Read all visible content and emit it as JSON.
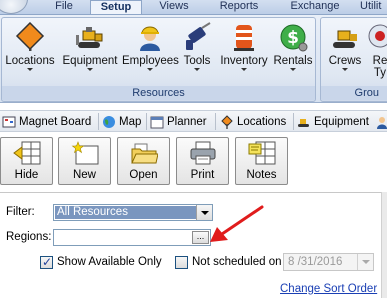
{
  "tabs": [
    {
      "label": "File"
    },
    {
      "label": "Setup"
    },
    {
      "label": "Views"
    },
    {
      "label": "Reports"
    },
    {
      "label": "Exchange"
    },
    {
      "label": "Utilit"
    }
  ],
  "ribbon": {
    "resources_label": "Resources",
    "group_label_clipped": "Grou",
    "buttons": {
      "locations": "Locations",
      "equipment": "Equipment",
      "employees": "Employees",
      "tools": "Tools",
      "inventory": "Inventory",
      "rentals": "Rentals",
      "crews": "Crews",
      "req_line1": "Re",
      "req_line2": "Ty"
    }
  },
  "navbar": {
    "magnet_board": "Magnet Board",
    "map": "Map",
    "planner": "Planner",
    "locations": "Locations",
    "equipment": "Equipment"
  },
  "actions": {
    "hide": "Hide",
    "new": "New",
    "open": "Open",
    "print": "Print",
    "notes": "Notes"
  },
  "filter": {
    "filter_label": "Filter:",
    "filter_value": "All Resources",
    "regions_label": "Regions:",
    "regions_value": "",
    "ellipsis": "...",
    "show_available_label": "Show Available Only",
    "show_available_checked": true,
    "not_scheduled_label": "Not scheduled on",
    "not_scheduled_checked": false,
    "date_value": "8 /31/2016",
    "change_sort": "Change Sort Order"
  },
  "colors": {
    "accent_arrow": "#e01c1c",
    "selected_fill": "#7a96bf",
    "link": "#1a3fb4"
  }
}
